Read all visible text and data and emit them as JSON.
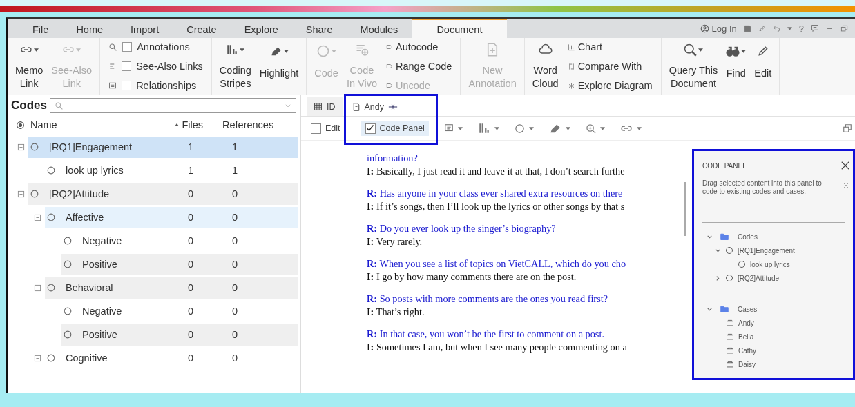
{
  "menu_tabs": [
    {
      "label": "File",
      "selected": false
    },
    {
      "label": "Home",
      "selected": false
    },
    {
      "label": "Import",
      "selected": false
    },
    {
      "label": "Create",
      "selected": false
    },
    {
      "label": "Explore",
      "selected": false
    },
    {
      "label": "Share",
      "selected": false
    },
    {
      "label": "Modules",
      "selected": false
    },
    {
      "label": "Document",
      "selected": true
    }
  ],
  "account": {
    "label": "Log In",
    "help": "?"
  },
  "ribbon_groups": [
    {
      "items": [
        {
          "kind": "big",
          "lines": [
            "Memo",
            "Link"
          ],
          "disabled": false
        },
        {
          "kind": "big",
          "lines": [
            "See-Also",
            "Link"
          ],
          "disabled": true
        }
      ]
    },
    {
      "items": [
        {
          "kind": "check",
          "label": "Annotations",
          "checked": false
        },
        {
          "kind": "check",
          "label": "See-Also Links",
          "checked": false
        },
        {
          "kind": "check",
          "label": "Relationships",
          "checked": false
        }
      ]
    },
    {
      "items": [
        {
          "kind": "big",
          "lines": [
            "Coding",
            "Stripes"
          ],
          "disabled": false
        },
        {
          "kind": "big",
          "lines": [
            "Highlight"
          ],
          "disabled": false
        }
      ]
    },
    {
      "items": [
        {
          "kind": "big",
          "lines": [
            "Code"
          ],
          "disabled": true
        },
        {
          "kind": "big",
          "lines": [
            "Code",
            "In Vivo"
          ],
          "disabled": true
        },
        {
          "kind": "small",
          "label": "Autocode",
          "disabled": false
        },
        {
          "kind": "small",
          "label": "Range Code",
          "disabled": false
        },
        {
          "kind": "small",
          "label": "Uncode",
          "disabled": true
        }
      ]
    },
    {
      "items": [
        {
          "kind": "big",
          "lines": [
            "New",
            "Annotation"
          ],
          "disabled": true
        }
      ]
    },
    {
      "items": [
        {
          "kind": "big",
          "lines": [
            "Word",
            "Cloud"
          ],
          "disabled": false
        },
        {
          "kind": "small",
          "label": "Chart",
          "disabled": false
        },
        {
          "kind": "small",
          "label": "Compare With",
          "disabled": false
        },
        {
          "kind": "small",
          "label": "Explore Diagram",
          "disabled": false
        }
      ]
    },
    {
      "items": [
        {
          "kind": "big",
          "lines": [
            "Query This",
            "Document"
          ],
          "disabled": false
        },
        {
          "kind": "big",
          "lines": [
            "Find"
          ],
          "disabled": false
        },
        {
          "kind": "big",
          "lines": [
            "Edit"
          ],
          "disabled": false
        }
      ]
    }
  ],
  "codes_pane": {
    "title": "Codes",
    "columns": [
      {
        "label": "Name",
        "sorted": false
      },
      {
        "label": "Files",
        "sorted": true
      },
      {
        "label": "References",
        "sorted": false
      }
    ],
    "rows": [
      {
        "name": "[RQ1]Engagement",
        "files": "1",
        "references": "1",
        "selected": true,
        "focused": false,
        "shaded": false,
        "expanded": true,
        "children": [
          {
            "name": "look up lyrics",
            "files": "1",
            "references": "1",
            "selected": false,
            "focused": false,
            "shaded": false
          }
        ]
      },
      {
        "name": "[RQ2]Attitude",
        "files": "0",
        "references": "0",
        "selected": false,
        "focused": false,
        "shaded": true,
        "expanded": true,
        "children": [
          {
            "name": "Affective",
            "files": "0",
            "references": "0",
            "selected": false,
            "focused": true,
            "shaded": false,
            "expanded": true,
            "children": [
              {
                "name": "Negative",
                "files": "0",
                "references": "0",
                "selected": false,
                "focused": false,
                "shaded": false
              },
              {
                "name": "Positive",
                "files": "0",
                "references": "0",
                "selected": false,
                "focused": false,
                "shaded": true
              }
            ]
          },
          {
            "name": "Behavioral",
            "files": "0",
            "references": "0",
            "selected": false,
            "focused": false,
            "shaded": true,
            "expanded": true,
            "children": [
              {
                "name": "Negative",
                "files": "0",
                "references": "0",
                "selected": false,
                "focused": false,
                "shaded": false
              },
              {
                "name": "Positive",
                "files": "0",
                "references": "0",
                "selected": false,
                "focused": false,
                "shaded": true
              }
            ]
          },
          {
            "name": "Cognitive",
            "files": "0",
            "references": "0",
            "selected": false,
            "focused": false,
            "shaded": false,
            "expanded": true
          }
        ]
      }
    ]
  },
  "doc_tabs": [
    {
      "label": "ID",
      "selected": false
    },
    {
      "label": "Andy",
      "selected": true
    }
  ],
  "doc_checks": [
    {
      "label": "Edit",
      "checked": false
    },
    {
      "label": "Code Panel",
      "checked": true
    }
  ],
  "transcript": [
    {
      "kind": "question",
      "text": "information?"
    },
    {
      "kind": "answer",
      "text": "**I:** Basically, I just read it and leave it at that, I don’t search furthe"
    },
    {
      "kind": "question",
      "text": "**R:** Has anyone in your class ever shared extra resources on there"
    },
    {
      "kind": "answer",
      "text": "**I:** If it’s songs, then I’ll look up the lyrics or other songs by that s"
    },
    {
      "kind": "question",
      "text": "**R:** Do you ever look up the singer’s biography?"
    },
    {
      "kind": "answer",
      "text": "**I:** Very rarely."
    },
    {
      "kind": "question",
      "text": "**R:** When you see a list of topics on VietCALL, which do you cho"
    },
    {
      "kind": "answer",
      "text": "**I:** I go by how many comments there are on the post."
    },
    {
      "kind": "question",
      "text": "**R:** So posts with more comments are the ones you read first?"
    },
    {
      "kind": "answer",
      "text": "**I:** That’s right."
    },
    {
      "kind": "question",
      "text": "**R:** In that case, you won’t be the first to comment on a post."
    },
    {
      "kind": "answer",
      "text": "**I:** Sometimes I am, but when I see many people commenting on a"
    }
  ],
  "code_panel": {
    "title": "CODE PANEL",
    "hint": "Drag selected content into this panel to code to existing codes and cases.",
    "sections": [
      {
        "label": "Codes",
        "kind": "codes",
        "expanded": true,
        "children": [
          {
            "label": "[RQ1]Engagement",
            "expanded": true,
            "children": [
              {
                "label": "look up lyrics"
              }
            ]
          },
          {
            "label": "[RQ2]Attitude",
            "expanded": false
          }
        ]
      },
      {
        "label": "Cases",
        "kind": "cases",
        "expanded": true,
        "children": [
          {
            "label": "Andy"
          },
          {
            "label": "Bella"
          },
          {
            "label": "Cathy"
          },
          {
            "label": "Daisy"
          }
        ]
      }
    ]
  }
}
